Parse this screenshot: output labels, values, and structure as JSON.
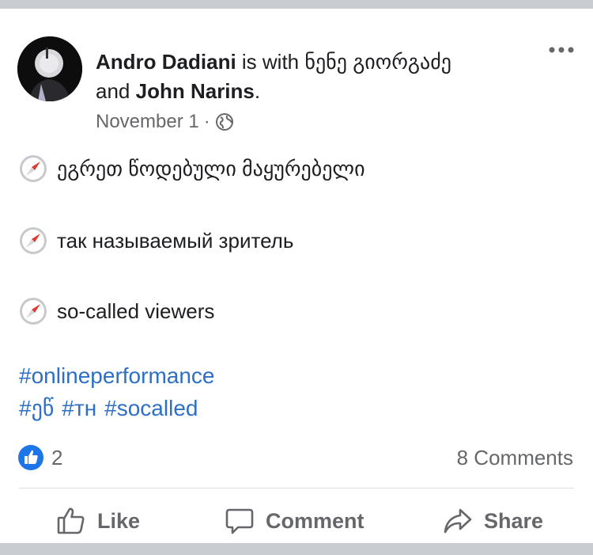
{
  "post": {
    "author": "Andro Dadiani",
    "with_text": "is with",
    "tagged_1": "ნენე გიორგაძე",
    "and_text": "and",
    "tagged_2": "John Narins",
    "period": ".",
    "date": "November 1",
    "separator": "·",
    "privacy_icon": "globe-icon",
    "more_icon": "ellipsis-icon",
    "lines": [
      "ეგრეთ წოდებული მაყურებელი",
      "так называемый зритель",
      "so-called viewers"
    ],
    "line_icon": "compass-icon",
    "hashtags": {
      "line1": "#onlineperformance",
      "line2": [
        "#ეწ",
        "#тн",
        "#socalled"
      ]
    }
  },
  "stats": {
    "like_count": "2",
    "comments": "8 Comments"
  },
  "actions": {
    "like": "Like",
    "comment": "Comment",
    "share": "Share"
  },
  "colors": {
    "link": "#2d6fc4",
    "like_blue": "#1d75e8",
    "secondary_text": "#65676b",
    "page_bg": "#c9ccd1"
  }
}
